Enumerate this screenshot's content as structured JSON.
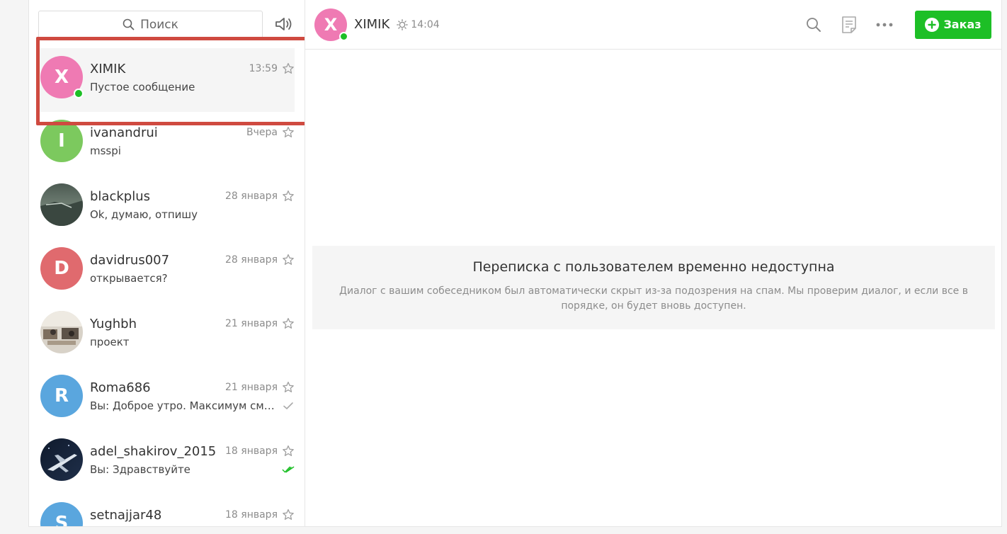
{
  "search": {
    "placeholder": "Поиск"
  },
  "chats": [
    {
      "name": "XIMIK",
      "date": "13:59",
      "message": "Пустое сообщение",
      "initial": "X",
      "avatar_color": "#ef7ab3",
      "online": true
    },
    {
      "name": "ivanandrui",
      "date": "Вчера",
      "message": "msspi",
      "initial": "I",
      "avatar_color": "#7cc95e"
    },
    {
      "name": "blackplus",
      "date": "28 января",
      "message": "Ok, думаю, отпишу",
      "avatar": "photo-landscape"
    },
    {
      "name": "davidrus007",
      "date": "28 января",
      "message": "открывается?",
      "initial": "D",
      "avatar_color": "#e06a6e"
    },
    {
      "name": "Yughbh",
      "date": "21 января",
      "message": "проект",
      "avatar": "photo-office"
    },
    {
      "name": "Roma686",
      "date": "21 января",
      "message": "Вы: Доброе утро. Максимум смо...",
      "initial": "R",
      "avatar_color": "#5aa6de",
      "status": "sent"
    },
    {
      "name": "adel_shakirov_2015",
      "date": "18 января",
      "message": "Вы: Здравствуйте",
      "avatar": "photo-airplane",
      "status": "read"
    },
    {
      "name": "setnajjar48",
      "date": "18 января",
      "message": "",
      "initial": "S",
      "avatar_color": "#5aa6de"
    }
  ],
  "header": {
    "initial": "X",
    "name": "XIMIK",
    "time": "14:04",
    "order_label": "Заказ"
  },
  "notice": {
    "title": "Переписка с пользователем временно недоступна",
    "text": "Диалог с вашим собеседником был автоматически скрыт из-за подозрения на спам. Мы проверим диалог, и если все в порядке, он будет вновь доступен."
  },
  "colors": {
    "accent": "#1dbf26",
    "highlight": "#cf4a40"
  }
}
